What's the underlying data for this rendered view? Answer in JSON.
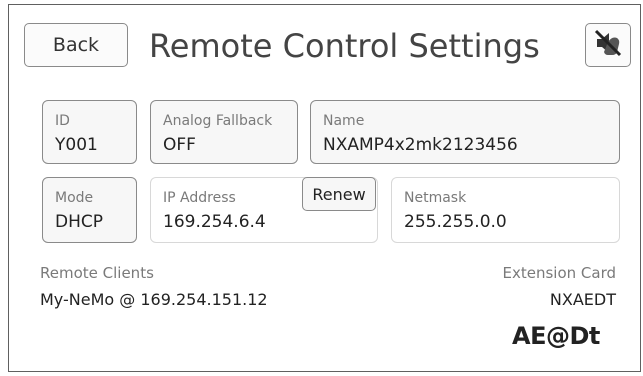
{
  "header": {
    "back_label": "Back",
    "title": "Remote Control Settings",
    "mute_icon": "speaker-muted-hand-icon"
  },
  "fields": {
    "id": {
      "label": "ID",
      "value": "Y001"
    },
    "analog_fallback": {
      "label": "Analog Fallback",
      "value": "OFF"
    },
    "name": {
      "label": "Name",
      "value": "NXAMP4x2mk2123456"
    },
    "mode": {
      "label": "Mode",
      "value": "DHCP"
    },
    "ip_address": {
      "label": "IP Address",
      "value": "169.254.6.4"
    },
    "netmask": {
      "label": "Netmask",
      "value": "255.255.0.0"
    }
  },
  "renew_label": "Renew",
  "remote_clients": {
    "label": "Remote Clients",
    "value": "My-NeMo @ 169.254.151.12"
  },
  "extension_card": {
    "label": "Extension Card",
    "value": "NXAEDT"
  },
  "logo": {
    "text": "AE@Dt"
  },
  "colors": {
    "border_active": "#8a8a8a",
    "border_inactive": "#d8d8d8",
    "label_grey": "#7a7a7a"
  }
}
